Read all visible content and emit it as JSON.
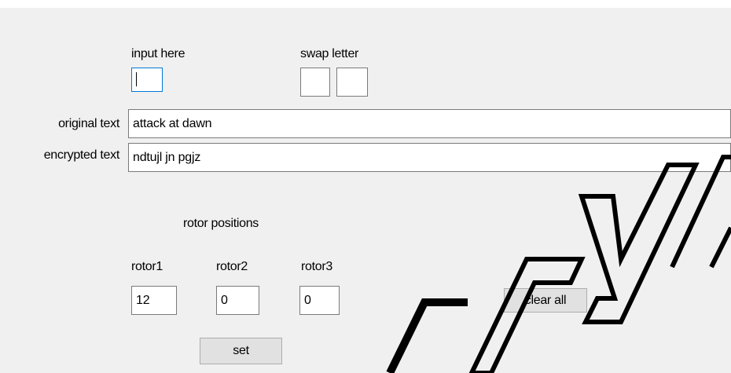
{
  "labels": {
    "input_here": "input here",
    "swap_letter": "swap letter",
    "original_text": "original text",
    "encrypted_text": "encrypted text",
    "rotor_positions": "rotor positions",
    "rotor1": "rotor1",
    "rotor2": "rotor2",
    "rotor3": "rotor3"
  },
  "fields": {
    "input": "",
    "swap_a": "",
    "swap_b": "",
    "original": "attack at dawn",
    "encrypted": "ndtujl jn pgjz",
    "rotor1": "12",
    "rotor2": "0",
    "rotor3": "0"
  },
  "buttons": {
    "clear_all": "clear all",
    "set": "set"
  },
  "watermark": {
    "text": "БГУИ",
    "color": "#000000"
  },
  "colors": {
    "focus_border": "#0078d7",
    "form_background": "#f0f0f0",
    "button_background": "#e1e1e1"
  }
}
